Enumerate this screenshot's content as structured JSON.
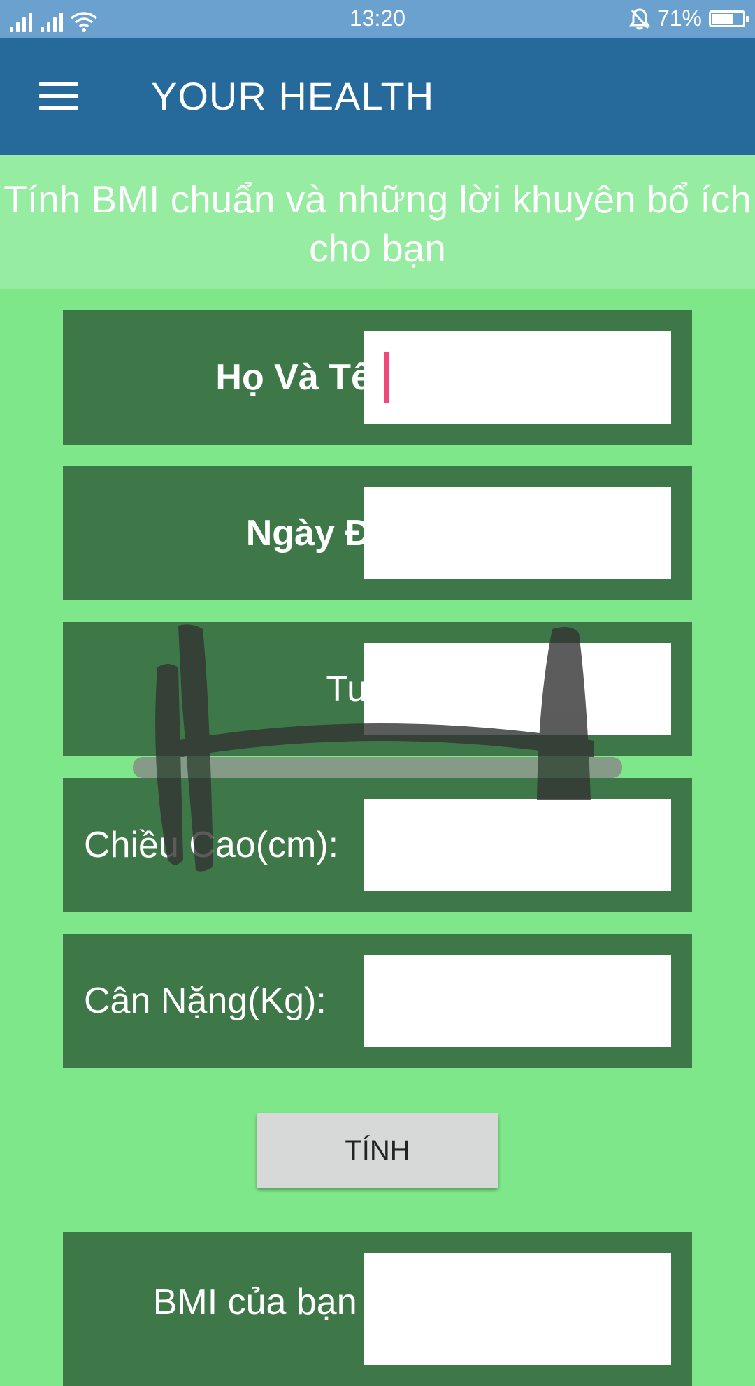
{
  "status_bar": {
    "time": "13:20",
    "battery_text": "71%",
    "battery_level": 0.71
  },
  "app_bar": {
    "title": "YOUR HEALTH"
  },
  "subtitle": "Tính BMI chuẩn và những lời khuyên bổ ích cho bạn",
  "form": {
    "name_label": "Họ Và Tên:",
    "date_label": "Ngày Đo:",
    "age_label": "Tuổi:",
    "height_label": "Chiều Cao(cm):",
    "weight_label": "Cân Nặng(Kg):",
    "name_value": "",
    "date_value": "",
    "age_value": "",
    "height_value": "",
    "weight_value": ""
  },
  "calc_button": "TÍNH",
  "result": {
    "label": "BMI của bạn là:",
    "value": ""
  },
  "colors": {
    "status_bar": "#6aa1cf",
    "app_bar": "#266a9c",
    "background": "#7ee78a",
    "subtitle_bg": "#96eca0",
    "row_bg": "#3d7647",
    "cursor": "#f0487a"
  }
}
